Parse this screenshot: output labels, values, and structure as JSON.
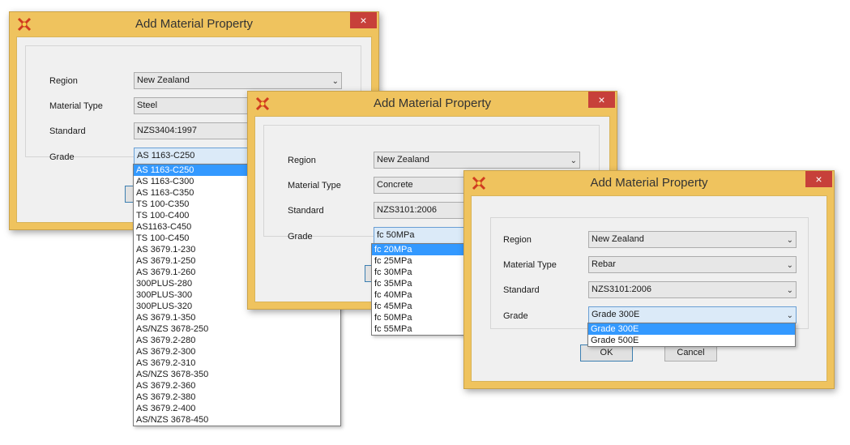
{
  "dialogs": [
    {
      "title": "Add Material Property",
      "close": "×",
      "fields": [
        {
          "label": "Region",
          "value": "New Zealand"
        },
        {
          "label": "Material Type",
          "value": "Steel"
        },
        {
          "label": "Standard",
          "value": "NZS3404:1997"
        },
        {
          "label": "Grade",
          "value": "AS 1163-C250"
        }
      ],
      "dropdown_options": [
        "AS 1163-C250",
        "AS 1163-C300",
        "AS 1163-C350",
        "TS 100-C350",
        "TS 100-C400",
        "AS1163-C450",
        "TS 100-C450",
        "AS 3679.1-230",
        "AS 3679.1-250",
        "AS 3679.1-260",
        "300PLUS-280",
        "300PLUS-300",
        "300PLUS-320",
        "AS 3679.1-350",
        "AS/NZS 3678-250",
        "AS 3679.2-280",
        "AS 3679.2-300",
        "AS 3679.2-310",
        "AS/NZS 3678-350",
        "AS 3679.2-360",
        "AS 3679.2-380",
        "AS 3679.2-400",
        "AS/NZS 3678-450"
      ]
    },
    {
      "title": "Add Material Property",
      "close": "×",
      "fields": [
        {
          "label": "Region",
          "value": "New Zealand"
        },
        {
          "label": "Material Type",
          "value": "Concrete"
        },
        {
          "label": "Standard",
          "value": "NZS3101:2006"
        },
        {
          "label": "Grade",
          "value": "fc 50MPa"
        }
      ],
      "dropdown_options": [
        "fc 20MPa",
        "fc 25MPa",
        "fc 30MPa",
        "fc 35MPa",
        "fc 40MPa",
        "fc 45MPa",
        "fc 50MPa",
        "fc 55MPa"
      ]
    },
    {
      "title": "Add Material Property",
      "close": "×",
      "fields": [
        {
          "label": "Region",
          "value": "New Zealand"
        },
        {
          "label": "Material Type",
          "value": "Rebar"
        },
        {
          "label": "Standard",
          "value": "NZS3101:2006"
        },
        {
          "label": "Grade",
          "value": "Grade 300E"
        }
      ],
      "dropdown_options": [
        "Grade 300E",
        "Grade 500E"
      ],
      "ok_label": "OK",
      "cancel_label": "Cancel"
    }
  ],
  "icons": {
    "app": "app-logo-icon",
    "close": "close-icon",
    "dropdown": "chevron-down-icon"
  },
  "colors": {
    "title_bar": "#efc35e",
    "close_button": "#c7403a",
    "selection": "#3399ff"
  }
}
